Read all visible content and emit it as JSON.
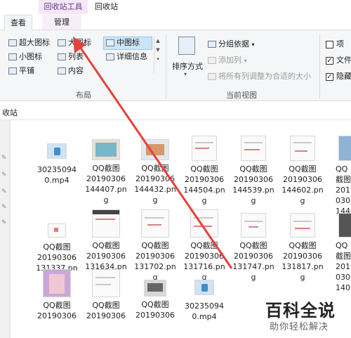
{
  "ribbon": {
    "tools_header": "回收站工具",
    "window_title": "回收站",
    "tab_view": "查看",
    "tab_manage": "管理",
    "layout": {
      "items": [
        {
          "label": "超大图标"
        },
        {
          "label": "大图标"
        },
        {
          "label": "中图标"
        },
        {
          "label": "小图标"
        },
        {
          "label": "列表"
        },
        {
          "label": "详细信息"
        },
        {
          "label": "平铺"
        },
        {
          "label": "内容"
        }
      ],
      "group_label": "布局"
    },
    "current_view": {
      "sort_by": "排序方式",
      "group_by": "分组依据",
      "add_column": "添加列",
      "fit_columns": "将所有列调整为合适的大小",
      "group_label": "当前视图"
    },
    "show_hide": {
      "items": [
        {
          "label": "项",
          "checked": false
        },
        {
          "label": "文件",
          "checked": true
        },
        {
          "label": "隐藏",
          "checked": true
        }
      ]
    }
  },
  "address": {
    "text": "收站"
  },
  "files": [
    {
      "line1": "30235094",
      "line2": "0.mp4",
      "line3": ""
    },
    {
      "line1": "QQ截图",
      "line2": "20190306",
      "line3": "144407.pn",
      "line4": "g"
    },
    {
      "line1": "QQ截图",
      "line2": "20190306",
      "line3": "144432.pn",
      "line4": "g"
    },
    {
      "line1": "QQ截图",
      "line2": "20190306",
      "line3": "144504.pn",
      "line4": "g"
    },
    {
      "line1": "QQ截图",
      "line2": "20190306",
      "line3": "144539.pn",
      "line4": "g"
    },
    {
      "line1": "QQ截图",
      "line2": "20190306",
      "line3": "144602.pn",
      "line4": "g"
    },
    {
      "line1": "QQ截图",
      "line2": "2019030",
      "line3": "1446",
      "line4": ""
    },
    {
      "line1": "QQ截图",
      "line2": "20190306",
      "line3": "131337.pn",
      "line4": "g"
    },
    {
      "line1": "QQ截图",
      "line2": "20190306",
      "line3": "131634.pn",
      "line4": "g"
    },
    {
      "line1": "QQ截图",
      "line2": "20190306",
      "line3": "131702.pn",
      "line4": "g"
    },
    {
      "line1": "QQ截图",
      "line2": "20190306",
      "line3": "131716.pn",
      "line4": "g"
    },
    {
      "line1": "QQ截图",
      "line2": "20190306",
      "line3": "131747.pn",
      "line4": "g"
    },
    {
      "line1": "QQ截图",
      "line2": "20190306",
      "line3": "131817.pn",
      "line4": "g"
    },
    {
      "line1": "QQ截图",
      "line2": "2019030",
      "line3": "1408",
      "line4": ""
    },
    {
      "line1": "QQ截图",
      "line2": "20190306"
    },
    {
      "line1": "QQ截图",
      "line2": "20190306"
    },
    {
      "line1": "QQ截图",
      "line2": "20190306"
    },
    {
      "line1": "30235094",
      "line2": "0.mp4"
    }
  ],
  "watermark": {
    "title": "百科全说",
    "subtitle": "助你轻松解决"
  },
  "colors": {
    "accent_red": "#e8403a",
    "tools_purple": "#6a3a86",
    "selection_blue": "#cce4f7"
  }
}
